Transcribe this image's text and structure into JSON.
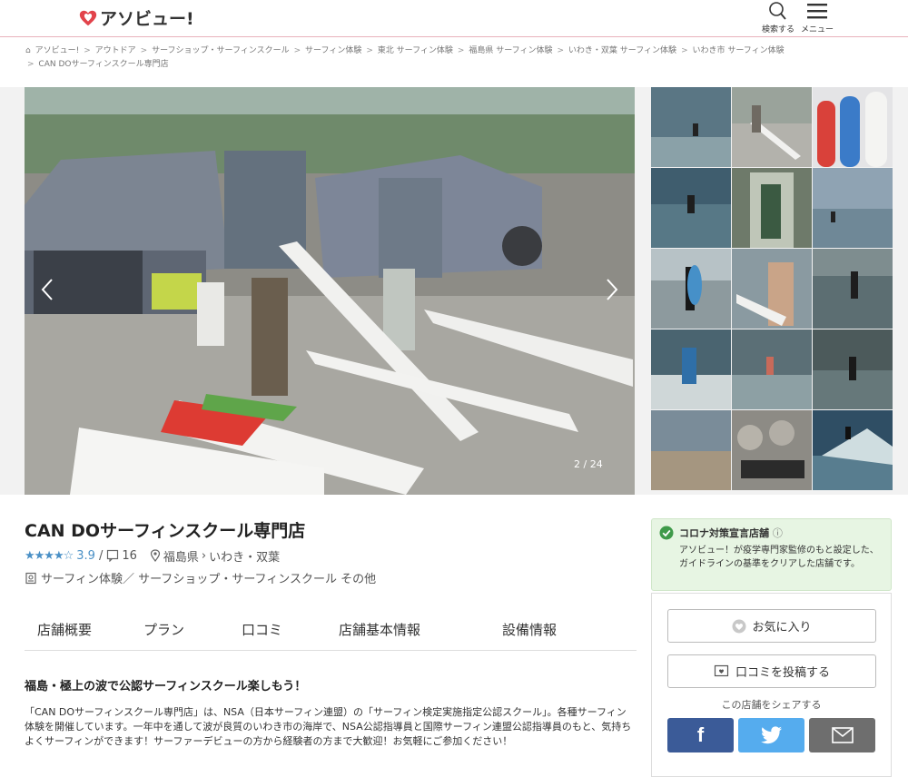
{
  "header": {
    "logo_text": "アソビュー!",
    "search_label": "検索する",
    "menu_label": "メニュー",
    "brand_color": "#e2434b"
  },
  "breadcrumb": [
    "アソビュー!",
    "アウトドア",
    "サーフショップ・サーフィンスクール",
    "サーフィン体験",
    "東北 サーフィン体験",
    "福島県 サーフィン体験",
    "いわき・双葉 サーフィン体験",
    "いわき市 サーフィン体験",
    "CAN DOサーフィンスクール専門店"
  ],
  "gallery": {
    "counter": "2 / 24"
  },
  "shop": {
    "title": "CAN DOサーフィンスクール専門店",
    "stars": "★★★★☆",
    "rating": "3.9",
    "separator": "/",
    "review_count": "16",
    "location_pref": "福島県",
    "location_area": "いわき・双葉",
    "categories": "サーフィン体験／ サーフショップ・サーフィンスクール その他"
  },
  "tabs": [
    "店舗概要",
    "プラン",
    "口コミ",
    "店舗基本情報",
    "設備情報"
  ],
  "intro": {
    "title": "福島・極上の波で公認サーフィンスクール楽しもう！",
    "body": "「CAN DOサーフィンスクール専門店」は、NSA（日本サーフィン連盟）の「サーフィン検定実施指定公認スクール」。各種サーフィン体験を開催しています。一年中を通して波が良質のいわき市の海岸で、NSA公認指導員と国際サーフィン連盟公認指導員のもと、気持ちよくサーフィンができます！サーファーデビューの方から経験者の方まで大歓迎！お気軽にご参加ください！"
  },
  "covid": {
    "title": "コロナ対策宣言店舗",
    "body": "アソビュー！が疫学専門家監修のもと設定した、ガイドラインの基準をクリアした店舗です。"
  },
  "sidebar": {
    "favorite_label": "お気に入り",
    "review_label": "口コミを投稿する",
    "share_label": "この店舗をシェアする",
    "facebook_color": "#3b5b98",
    "twitter_color": "#55acee",
    "mail_color": "#6e6e6e"
  }
}
